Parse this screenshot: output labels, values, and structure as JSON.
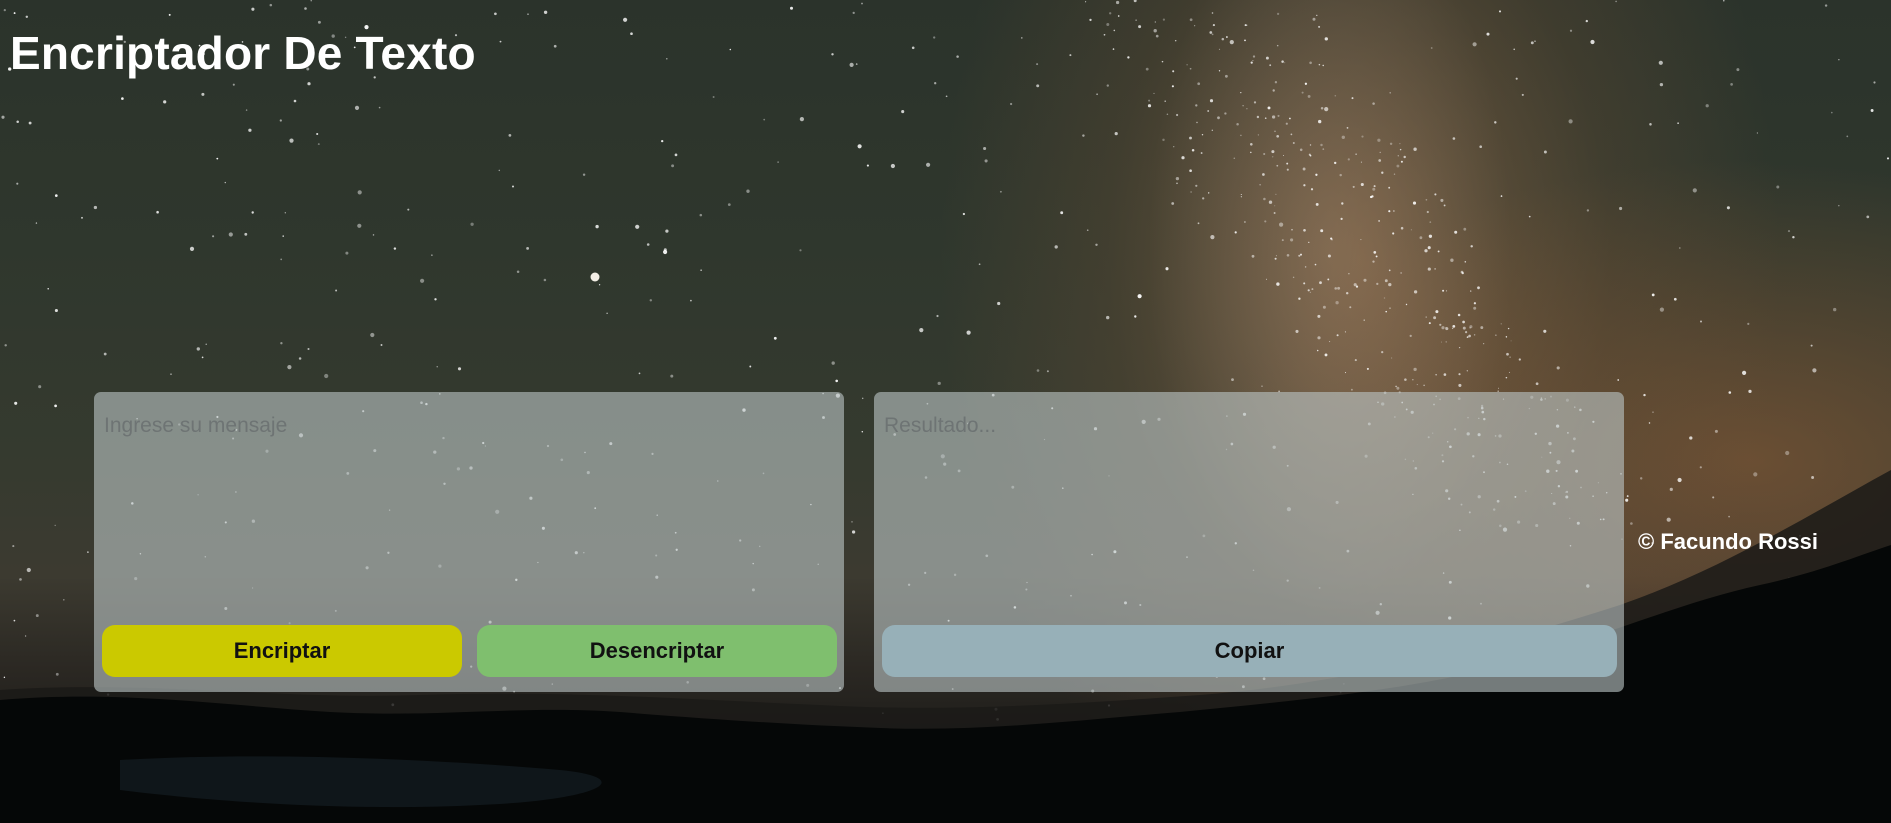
{
  "header": {
    "title": "Encriptador De Texto"
  },
  "input_panel": {
    "placeholder": "Ingrese su mensaje",
    "value": "",
    "encrypt_label": "Encriptar",
    "decrypt_label": "Desencriptar"
  },
  "output_panel": {
    "placeholder": "Resultado...",
    "value": "",
    "copy_label": "Copiar"
  },
  "footer": {
    "credit": "© Facundo Rossi"
  },
  "colors": {
    "encrypt_button": "#cbc900",
    "decrypt_button": "#7fbf6e",
    "copy_button": "#97b0b8",
    "title_text": "#ffffff"
  },
  "background": {
    "subject": "starry night sky with milky way over mountains"
  }
}
